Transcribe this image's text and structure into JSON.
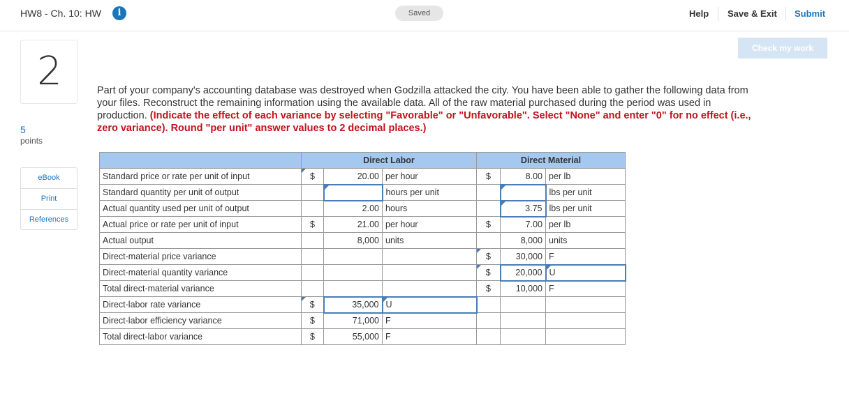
{
  "header": {
    "title": "HW8 - Ch. 10: HW",
    "info_icon": "info-icon",
    "saved_label": "Saved",
    "help_label": "Help",
    "save_exit_label": "Save & Exit",
    "submit_label": "Submit"
  },
  "question": {
    "number": "2",
    "points_value": "5",
    "points_label": "points",
    "tools": [
      "eBook",
      "Print",
      "References"
    ],
    "check_label": "Check my work",
    "text_plain": "Part of your company's accounting database was destroyed when Godzilla attacked the city. You have been able to gather the following data from your files. Reconstruct the remaining information using the available data. All of the raw material purchased during the period was used in production.",
    "text_instruction": "(Indicate the effect of each variance by selecting \"Favorable\" or \"Unfavorable\". Select \"None\" and enter \"0\" for no effect (i.e., zero variance). Round \"per unit\" answer values to 2 decimal places.)"
  },
  "table": {
    "dl_header": "Direct Labor",
    "dm_header": "Direct Material",
    "rows": [
      {
        "label": "Standard price or rate per unit of input",
        "dl_d": "$",
        "dl_v": "20.00",
        "dl_u": "per hour",
        "dm_d": "$",
        "dm_v": "8.00",
        "dm_u": "per lb"
      },
      {
        "label": "Standard quantity per unit of output",
        "dl_d": "",
        "dl_v": "",
        "dl_u": "hours per unit",
        "dm_d": "",
        "dm_v": "",
        "dm_u": "lbs per unit"
      },
      {
        "label": "Actual quantity used per unit of output",
        "dl_d": "",
        "dl_v": "2.00",
        "dl_u": "hours",
        "dm_d": "",
        "dm_v": "3.75",
        "dm_u": "lbs per unit"
      },
      {
        "label": "Actual price or rate per unit of input",
        "dl_d": "$",
        "dl_v": "21.00",
        "dl_u": "per hour",
        "dm_d": "$",
        "dm_v": "7.00",
        "dm_u": "per lb"
      },
      {
        "label": "Actual output",
        "dl_d": "",
        "dl_v": "8,000",
        "dl_u": "units",
        "dm_d": "",
        "dm_v": "8,000",
        "dm_u": "units"
      },
      {
        "label": "Direct-material price variance",
        "dl_d": "",
        "dl_v": "",
        "dl_u": "",
        "dm_d": "$",
        "dm_v": "30,000",
        "dm_u": "F"
      },
      {
        "label": "Direct-material quantity variance",
        "dl_d": "",
        "dl_v": "",
        "dl_u": "",
        "dm_d": "$",
        "dm_v": "20,000",
        "dm_u": "U"
      },
      {
        "label": "Total direct-material variance",
        "dl_d": "",
        "dl_v": "",
        "dl_u": "",
        "dm_d": "$",
        "dm_v": "10,000",
        "dm_u": "F"
      },
      {
        "label": "Direct-labor rate variance",
        "dl_d": "$",
        "dl_v": "35,000",
        "dl_u": "U",
        "dm_d": "",
        "dm_v": "",
        "dm_u": ""
      },
      {
        "label": "Direct-labor efficiency variance",
        "dl_d": "$",
        "dl_v": "71,000",
        "dl_u": "F",
        "dm_d": "",
        "dm_v": "",
        "dm_u": ""
      },
      {
        "label": "Total direct-labor variance",
        "dl_d": "$",
        "dl_v": "55,000",
        "dl_u": "F",
        "dm_d": "",
        "dm_v": "",
        "dm_u": ""
      }
    ]
  }
}
